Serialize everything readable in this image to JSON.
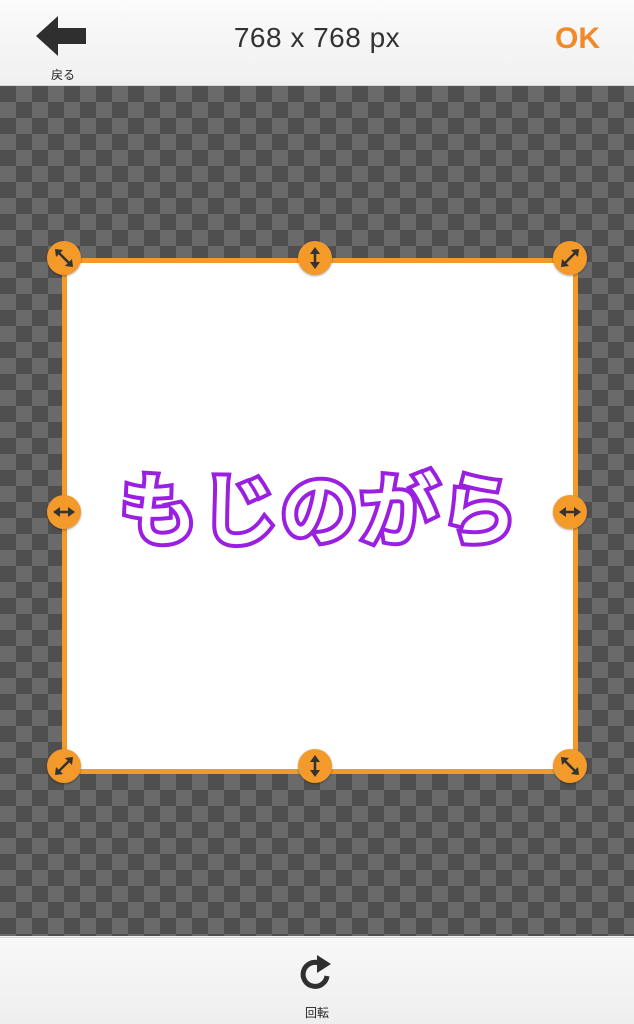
{
  "header": {
    "back_label": "戻る",
    "title": "768 x 768 px",
    "ok_label": "OK"
  },
  "canvas": {
    "text": "もじのがら",
    "text_stroke_color": "#9b1fe0",
    "handle_color": "#f39a2a"
  },
  "toolbar": {
    "rotate_label": "回転"
  },
  "icons": {
    "back": "arrow-left-icon",
    "rotate": "rotate-clockwise-icon",
    "resize": "resize-arrows-icon"
  }
}
